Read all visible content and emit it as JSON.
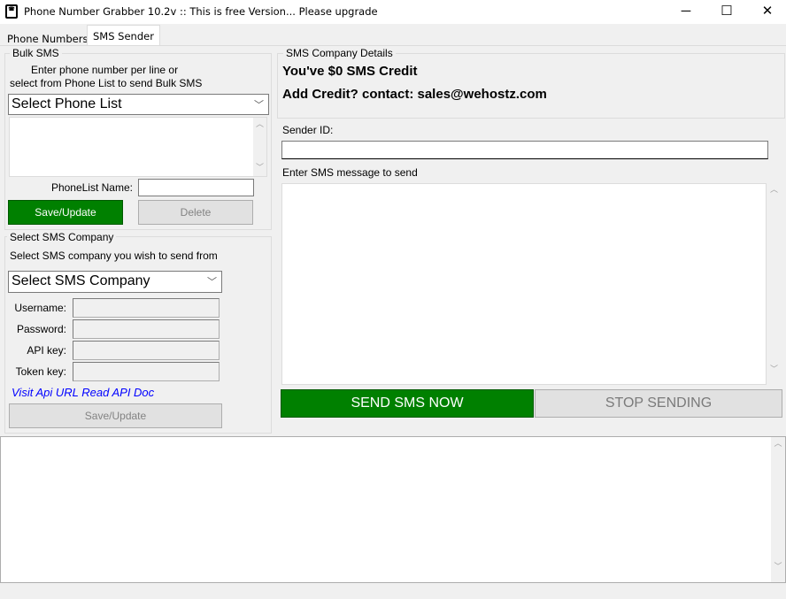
{
  "window": {
    "title": "Phone Number Grabber 10.2v ::  This is free Version... Please upgrade",
    "minimize": "─",
    "maximize": "☐",
    "close": "✕"
  },
  "tabs": [
    {
      "label": "Phone Numbers",
      "active": false
    },
    {
      "label": "SMS Sender",
      "active": true
    }
  ],
  "bulk_sms": {
    "legend": "Bulk SMS",
    "instructions_1": "Enter phone number per line or",
    "instructions_2": "select from Phone List to send Bulk SMS",
    "phone_list_select": "Select Phone List",
    "numbers_text": "",
    "phonelist_name_label": "PhoneList Name:",
    "phonelist_name_value": "",
    "save_label": "Save/Update",
    "delete_label": "Delete"
  },
  "sms_company": {
    "legend": "Select SMS Company",
    "instructions": "Select SMS company you wish to send from",
    "company_select": "Select SMS Company",
    "username_label": "Username:",
    "password_label": "Password:",
    "api_key_label": "API key:",
    "token_key_label": "Token key:",
    "visit_api_link": "Visit Api URL",
    "read_api_link": "Read API Doc",
    "save_label": "Save/Update"
  },
  "company_details": {
    "legend": "SMS Company Details",
    "credit": "You've $0 SMS Credit",
    "contact": "Add Credit? contact: sales@wehostz.com"
  },
  "sender": {
    "sender_id_label": "Sender ID:",
    "sender_id_value": "",
    "message_label": "Enter SMS message to send",
    "message_value": "",
    "send_label": "SEND SMS NOW",
    "stop_label": "STOP SENDING"
  },
  "log": {
    "text": ""
  },
  "colors": {
    "accent_green": "#008000",
    "link_blue": "#0000ff"
  }
}
